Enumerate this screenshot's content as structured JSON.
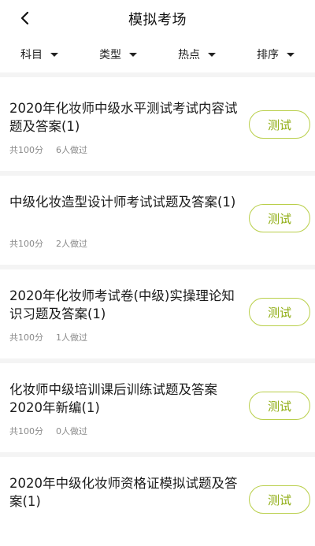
{
  "header": {
    "title": "模拟考场"
  },
  "filters": [
    {
      "label": "科目"
    },
    {
      "label": "类型"
    },
    {
      "label": "热点"
    },
    {
      "label": "排序"
    }
  ],
  "items": [
    {
      "title": "2020年化妆师中级水平测试考试内容试题及答案(1)",
      "score": "共100分",
      "count": "6人做过",
      "button": "测试"
    },
    {
      "title": "中级化妆造型设计师考试试题及答案(1)",
      "score": "共100分",
      "count": "2人做过",
      "button": "测试"
    },
    {
      "title": "2020年化妆师考试卷(中级)实操理论知识习题及答案(1)",
      "score": "共100分",
      "count": "1人做过",
      "button": "测试"
    },
    {
      "title": "化妆师中级培训课后训练试题及答案2020年新编(1)",
      "score": "共100分",
      "count": "0人做过",
      "button": "测试"
    },
    {
      "title": "2020年中级化妆师资格证模拟试题及答案(1)",
      "score": "",
      "count": "",
      "button": "测试"
    }
  ],
  "colors": {
    "accent": "#8fad12",
    "border": "#b9cf4a"
  }
}
